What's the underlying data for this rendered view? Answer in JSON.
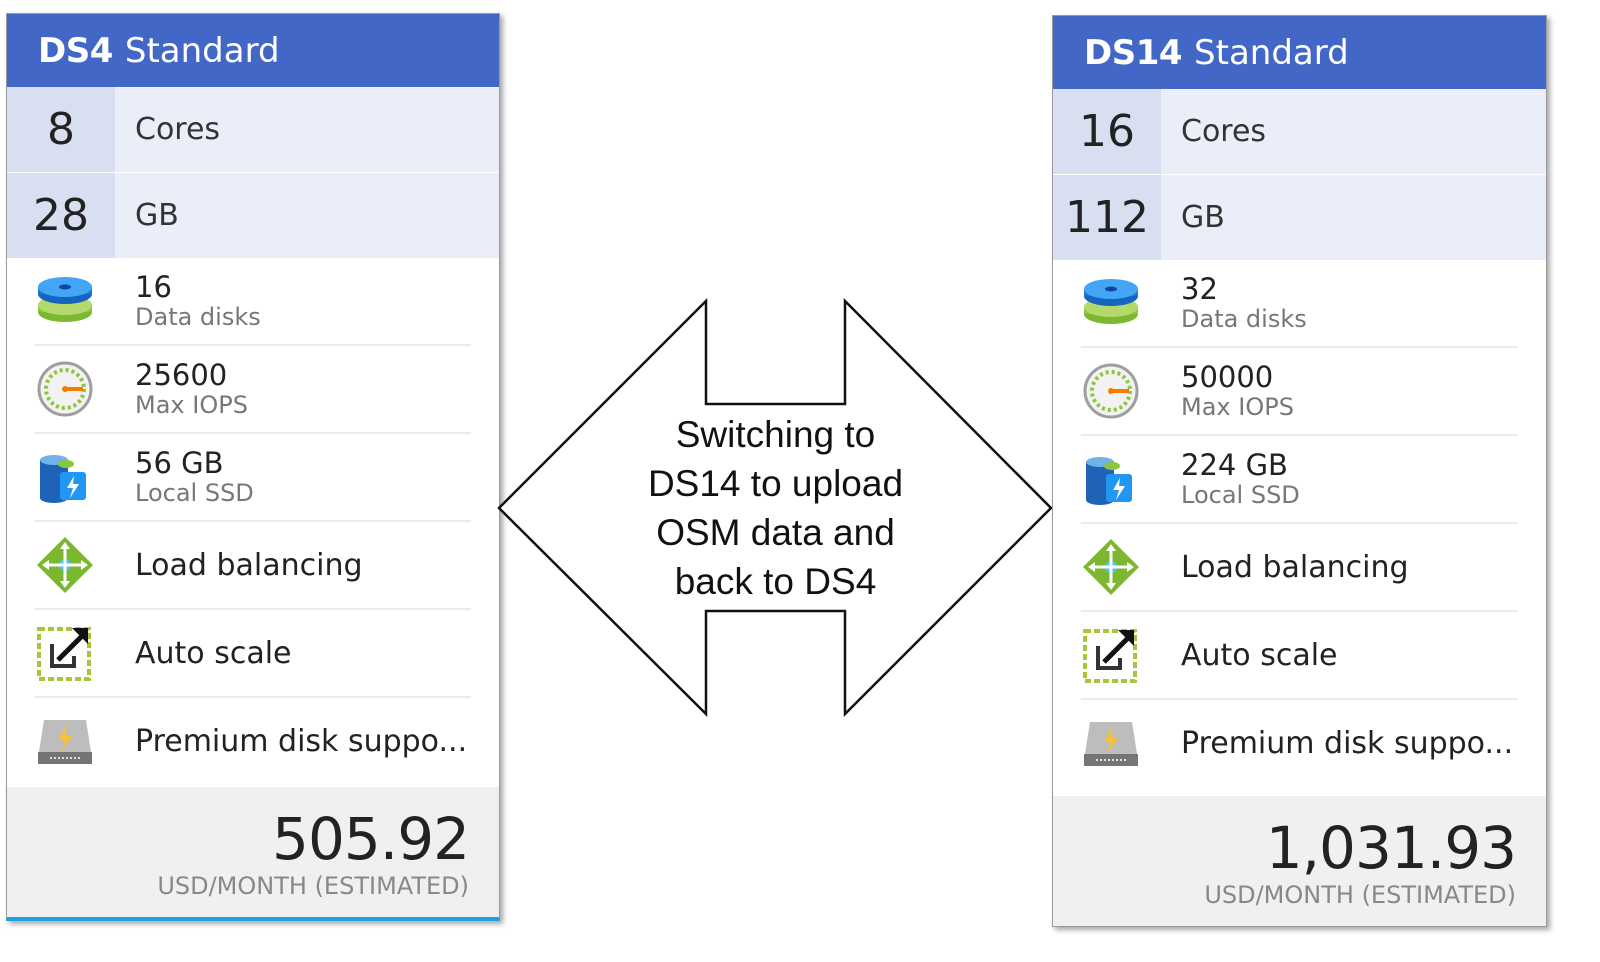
{
  "left_card": {
    "sku": "DS4",
    "tier": "Standard",
    "cores": "8",
    "cores_unit": "Cores",
    "memory": "28",
    "memory_unit": "GB",
    "data_disks_value": "16",
    "data_disks_label": "Data disks",
    "iops_value": "25600",
    "iops_label": "Max IOPS",
    "ssd_value": "56 GB",
    "ssd_label": "Local SSD",
    "load_balancing": "Load balancing",
    "auto_scale": "Auto scale",
    "premium_disk": "Premium disk suppo...",
    "price": "505.92",
    "price_caption": "USD/MONTH (ESTIMATED)"
  },
  "right_card": {
    "sku": "DS14",
    "tier": "Standard",
    "cores": "16",
    "cores_unit": "Cores",
    "memory": "112",
    "memory_unit": "GB",
    "data_disks_value": "32",
    "data_disks_label": "Data disks",
    "iops_value": "50000",
    "iops_label": "Max IOPS",
    "ssd_value": "224 GB",
    "ssd_label": "Local SSD",
    "load_balancing": "Load balancing",
    "auto_scale": "Auto scale",
    "premium_disk": "Premium disk suppo...",
    "price": "1,031.93",
    "price_caption": "USD/MONTH (ESTIMATED)"
  },
  "arrow": {
    "lines": [
      "Switching to",
      "DS14 to upload",
      "OSM data and",
      "back to DS4"
    ]
  },
  "colors": {
    "header_blue": "#4367c6",
    "spec_bg": "#e9eef9",
    "spec_num_bg": "#d7dff1",
    "accent_green": "#7cb82f",
    "accent_blue": "#1e88e5"
  },
  "icons": [
    "data-disks-icon",
    "iops-gauge-icon",
    "local-ssd-icon",
    "load-balancing-icon",
    "auto-scale-icon",
    "premium-disk-icon"
  ]
}
